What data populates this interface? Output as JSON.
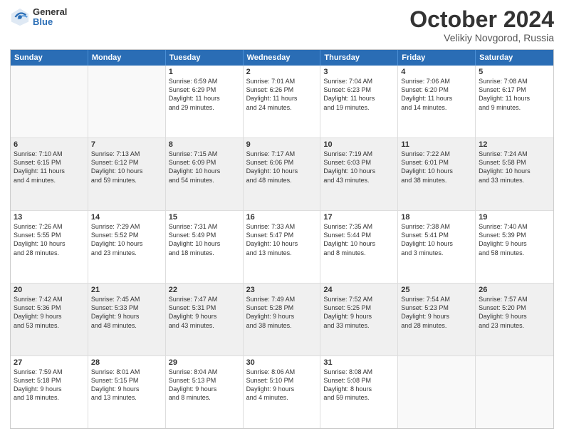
{
  "logo": {
    "general": "General",
    "blue": "Blue"
  },
  "header": {
    "title": "October 2024",
    "subtitle": "Velikiy Novgorod, Russia"
  },
  "days": [
    "Sunday",
    "Monday",
    "Tuesday",
    "Wednesday",
    "Thursday",
    "Friday",
    "Saturday"
  ],
  "rows": [
    [
      {
        "day": "",
        "lines": [],
        "empty": true
      },
      {
        "day": "",
        "lines": [],
        "empty": true
      },
      {
        "day": "1",
        "lines": [
          "Sunrise: 6:59 AM",
          "Sunset: 6:29 PM",
          "Daylight: 11 hours",
          "and 29 minutes."
        ]
      },
      {
        "day": "2",
        "lines": [
          "Sunrise: 7:01 AM",
          "Sunset: 6:26 PM",
          "Daylight: 11 hours",
          "and 24 minutes."
        ]
      },
      {
        "day": "3",
        "lines": [
          "Sunrise: 7:04 AM",
          "Sunset: 6:23 PM",
          "Daylight: 11 hours",
          "and 19 minutes."
        ]
      },
      {
        "day": "4",
        "lines": [
          "Sunrise: 7:06 AM",
          "Sunset: 6:20 PM",
          "Daylight: 11 hours",
          "and 14 minutes."
        ]
      },
      {
        "day": "5",
        "lines": [
          "Sunrise: 7:08 AM",
          "Sunset: 6:17 PM",
          "Daylight: 11 hours",
          "and 9 minutes."
        ]
      }
    ],
    [
      {
        "day": "6",
        "lines": [
          "Sunrise: 7:10 AM",
          "Sunset: 6:15 PM",
          "Daylight: 11 hours",
          "and 4 minutes."
        ]
      },
      {
        "day": "7",
        "lines": [
          "Sunrise: 7:13 AM",
          "Sunset: 6:12 PM",
          "Daylight: 10 hours",
          "and 59 minutes."
        ]
      },
      {
        "day": "8",
        "lines": [
          "Sunrise: 7:15 AM",
          "Sunset: 6:09 PM",
          "Daylight: 10 hours",
          "and 54 minutes."
        ]
      },
      {
        "day": "9",
        "lines": [
          "Sunrise: 7:17 AM",
          "Sunset: 6:06 PM",
          "Daylight: 10 hours",
          "and 48 minutes."
        ]
      },
      {
        "day": "10",
        "lines": [
          "Sunrise: 7:19 AM",
          "Sunset: 6:03 PM",
          "Daylight: 10 hours",
          "and 43 minutes."
        ]
      },
      {
        "day": "11",
        "lines": [
          "Sunrise: 7:22 AM",
          "Sunset: 6:01 PM",
          "Daylight: 10 hours",
          "and 38 minutes."
        ]
      },
      {
        "day": "12",
        "lines": [
          "Sunrise: 7:24 AM",
          "Sunset: 5:58 PM",
          "Daylight: 10 hours",
          "and 33 minutes."
        ]
      }
    ],
    [
      {
        "day": "13",
        "lines": [
          "Sunrise: 7:26 AM",
          "Sunset: 5:55 PM",
          "Daylight: 10 hours",
          "and 28 minutes."
        ]
      },
      {
        "day": "14",
        "lines": [
          "Sunrise: 7:29 AM",
          "Sunset: 5:52 PM",
          "Daylight: 10 hours",
          "and 23 minutes."
        ]
      },
      {
        "day": "15",
        "lines": [
          "Sunrise: 7:31 AM",
          "Sunset: 5:49 PM",
          "Daylight: 10 hours",
          "and 18 minutes."
        ]
      },
      {
        "day": "16",
        "lines": [
          "Sunrise: 7:33 AM",
          "Sunset: 5:47 PM",
          "Daylight: 10 hours",
          "and 13 minutes."
        ]
      },
      {
        "day": "17",
        "lines": [
          "Sunrise: 7:35 AM",
          "Sunset: 5:44 PM",
          "Daylight: 10 hours",
          "and 8 minutes."
        ]
      },
      {
        "day": "18",
        "lines": [
          "Sunrise: 7:38 AM",
          "Sunset: 5:41 PM",
          "Daylight: 10 hours",
          "and 3 minutes."
        ]
      },
      {
        "day": "19",
        "lines": [
          "Sunrise: 7:40 AM",
          "Sunset: 5:39 PM",
          "Daylight: 9 hours",
          "and 58 minutes."
        ]
      }
    ],
    [
      {
        "day": "20",
        "lines": [
          "Sunrise: 7:42 AM",
          "Sunset: 5:36 PM",
          "Daylight: 9 hours",
          "and 53 minutes."
        ]
      },
      {
        "day": "21",
        "lines": [
          "Sunrise: 7:45 AM",
          "Sunset: 5:33 PM",
          "Daylight: 9 hours",
          "and 48 minutes."
        ]
      },
      {
        "day": "22",
        "lines": [
          "Sunrise: 7:47 AM",
          "Sunset: 5:31 PM",
          "Daylight: 9 hours",
          "and 43 minutes."
        ]
      },
      {
        "day": "23",
        "lines": [
          "Sunrise: 7:49 AM",
          "Sunset: 5:28 PM",
          "Daylight: 9 hours",
          "and 38 minutes."
        ]
      },
      {
        "day": "24",
        "lines": [
          "Sunrise: 7:52 AM",
          "Sunset: 5:25 PM",
          "Daylight: 9 hours",
          "and 33 minutes."
        ]
      },
      {
        "day": "25",
        "lines": [
          "Sunrise: 7:54 AM",
          "Sunset: 5:23 PM",
          "Daylight: 9 hours",
          "and 28 minutes."
        ]
      },
      {
        "day": "26",
        "lines": [
          "Sunrise: 7:57 AM",
          "Sunset: 5:20 PM",
          "Daylight: 9 hours",
          "and 23 minutes."
        ]
      }
    ],
    [
      {
        "day": "27",
        "lines": [
          "Sunrise: 7:59 AM",
          "Sunset: 5:18 PM",
          "Daylight: 9 hours",
          "and 18 minutes."
        ]
      },
      {
        "day": "28",
        "lines": [
          "Sunrise: 8:01 AM",
          "Sunset: 5:15 PM",
          "Daylight: 9 hours",
          "and 13 minutes."
        ]
      },
      {
        "day": "29",
        "lines": [
          "Sunrise: 8:04 AM",
          "Sunset: 5:13 PM",
          "Daylight: 9 hours",
          "and 8 minutes."
        ]
      },
      {
        "day": "30",
        "lines": [
          "Sunrise: 8:06 AM",
          "Sunset: 5:10 PM",
          "Daylight: 9 hours",
          "and 4 minutes."
        ]
      },
      {
        "day": "31",
        "lines": [
          "Sunrise: 8:08 AM",
          "Sunset: 5:08 PM",
          "Daylight: 8 hours",
          "and 59 minutes."
        ]
      },
      {
        "day": "",
        "lines": [],
        "empty": true
      },
      {
        "day": "",
        "lines": [],
        "empty": true
      }
    ]
  ]
}
